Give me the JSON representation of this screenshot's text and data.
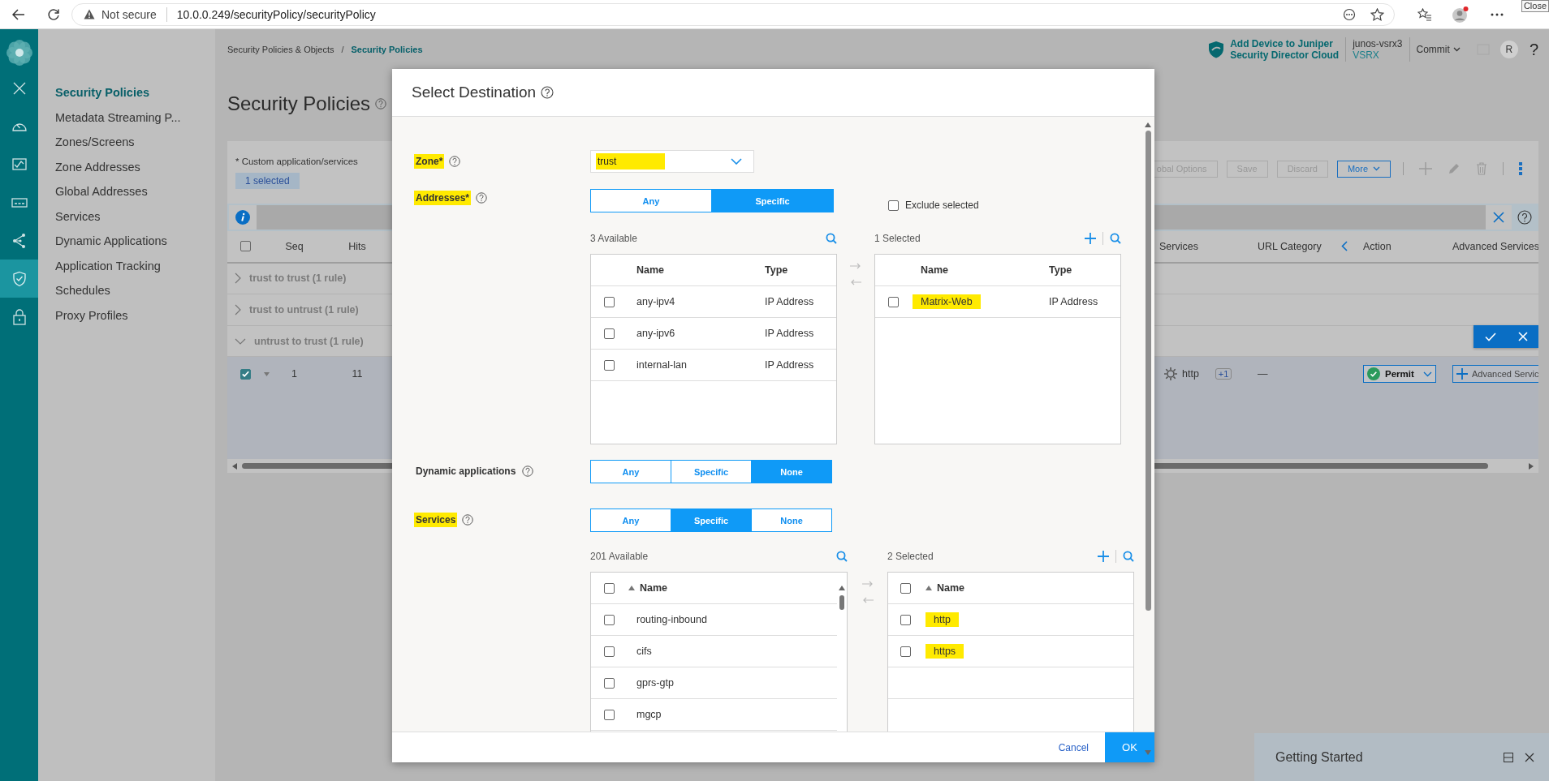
{
  "browser": {
    "security_label": "Not secure",
    "url": "10.0.0.249/securityPolicy/securityPolicy",
    "tooltip": "Close"
  },
  "rail": {
    "items": [
      {
        "kind": "close",
        "selected": false
      },
      {
        "kind": "dashboard",
        "selected": false
      },
      {
        "kind": "monitor",
        "selected": false
      },
      {
        "kind": "devices",
        "selected": false
      },
      {
        "kind": "network",
        "selected": false
      },
      {
        "kind": "security",
        "selected": true
      },
      {
        "kind": "lock",
        "selected": false
      }
    ]
  },
  "nav": {
    "items": [
      {
        "label": "Security Policies",
        "selected": true
      },
      {
        "label": "Metadata Streaming P...",
        "selected": false
      },
      {
        "label": "Zones/Screens",
        "selected": false
      },
      {
        "label": "Zone Addresses",
        "selected": false
      },
      {
        "label": "Global Addresses",
        "selected": false
      },
      {
        "label": "Services",
        "selected": false
      },
      {
        "label": "Dynamic Applications",
        "selected": false
      },
      {
        "label": "Application Tracking",
        "selected": false
      },
      {
        "label": "Schedules",
        "selected": false
      },
      {
        "label": "Proxy Profiles",
        "selected": false
      }
    ]
  },
  "header": {
    "breadcrumb": [
      "Security Policies & Objects",
      "Security Policies"
    ],
    "separator": "/",
    "promo": [
      "Add Device to Juniper",
      "Security Director Cloud"
    ],
    "device": {
      "name": "junos-vsrx3",
      "model": "VSRX"
    },
    "commit": "Commit",
    "avatar": "R",
    "help": "?"
  },
  "page": {
    "title": "Security Policies",
    "note": "* Custom application/services",
    "selection_badge": "1 selected",
    "toolbar": [
      {
        "label": "obal Options",
        "kind": "plain",
        "disabled": true
      },
      {
        "label": "Save",
        "kind": "plain",
        "disabled": true
      },
      {
        "label": "Discard",
        "kind": "plain",
        "disabled": true
      },
      {
        "label": "More",
        "kind": "dropdown",
        "disabled": false
      }
    ]
  },
  "table": {
    "select_all_checked": false,
    "left_columns": [
      "Seq",
      "Hits"
    ],
    "right_columns": [
      "Services",
      "URL Category",
      "Action",
      "Advanced Services"
    ],
    "groups": [
      {
        "label": "trust to trust (1 rule)",
        "expanded": false
      },
      {
        "label": "trust to untrust (1 rule)",
        "expanded": false
      },
      {
        "label": "untrust to trust (1 rule)",
        "expanded": true
      }
    ],
    "rule": {
      "selected": true,
      "seq": "1",
      "hits": "11",
      "service": "http",
      "service_more": "+1",
      "url_category": "—",
      "action": "Permit",
      "advanced": "Advanced Servic"
    }
  },
  "dialog": {
    "title": "Select Destination",
    "zone": {
      "label": "Zone*",
      "highlighted": true,
      "value": "trust",
      "value_highlighted": true
    },
    "addresses": {
      "label": "Addresses*",
      "highlighted": true,
      "options": [
        {
          "label": "Any",
          "selected": false
        },
        {
          "label": "Specific",
          "selected": true
        }
      ],
      "exclude": {
        "label": "Exclude selected",
        "checked": false
      },
      "available": {
        "count": "3 Available",
        "columns": [
          "Name",
          "Type"
        ],
        "rows": [
          {
            "name": "any-ipv4",
            "type": "IP Address",
            "checked": false,
            "highlighted": false
          },
          {
            "name": "any-ipv6",
            "type": "IP Address",
            "checked": false,
            "highlighted": false
          },
          {
            "name": "internal-lan",
            "type": "IP Address",
            "checked": false,
            "highlighted": false
          }
        ]
      },
      "chosen": {
        "count": "1 Selected",
        "columns": [
          "Name",
          "Type"
        ],
        "rows": [
          {
            "name": "Matrix-Web",
            "type": "IP Address",
            "checked": false,
            "highlighted": true
          }
        ]
      }
    },
    "dynamic_applications": {
      "label": "Dynamic applications",
      "highlighted": false,
      "options": [
        {
          "label": "Any",
          "selected": false
        },
        {
          "label": "Specific",
          "selected": false
        },
        {
          "label": "None",
          "selected": true
        }
      ]
    },
    "services": {
      "label": "Services",
      "highlighted": true,
      "options": [
        {
          "label": "Any",
          "selected": false
        },
        {
          "label": "Specific",
          "selected": true
        },
        {
          "label": "None",
          "selected": false
        }
      ],
      "available": {
        "count": "201 Available",
        "column": "Name",
        "all_checked": false,
        "rows": [
          {
            "name": "routing-inbound",
            "checked": false,
            "highlighted": false
          },
          {
            "name": "cifs",
            "checked": false,
            "highlighted": false
          },
          {
            "name": "gprs-gtp",
            "checked": false,
            "highlighted": false
          },
          {
            "name": "mgcp",
            "checked": false,
            "highlighted": false
          }
        ]
      },
      "chosen": {
        "count": "2 Selected",
        "column": "Name",
        "all_checked": false,
        "rows": [
          {
            "name": "http",
            "checked": false,
            "highlighted": true
          },
          {
            "name": "https",
            "checked": false,
            "highlighted": true
          }
        ]
      }
    },
    "cancel": "Cancel",
    "ok": "OK"
  },
  "getting_started": {
    "title": "Getting Started"
  }
}
